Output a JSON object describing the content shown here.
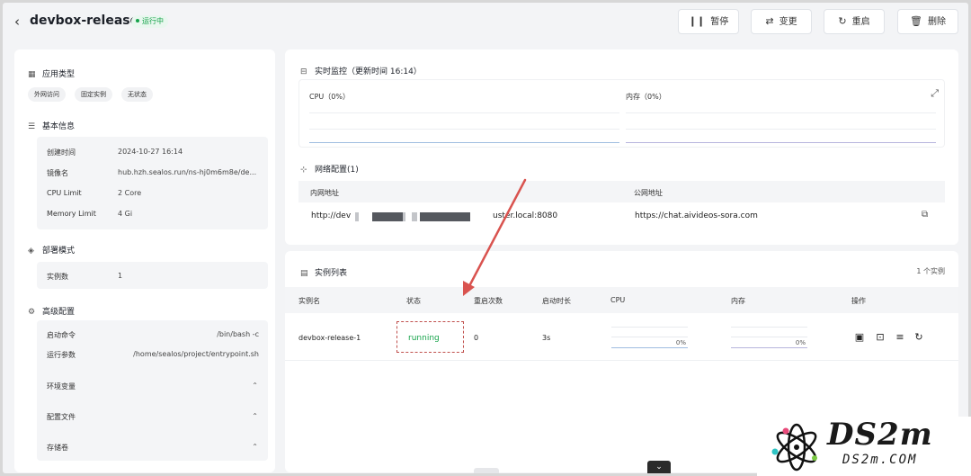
{
  "header": {
    "title": "devbox-release",
    "status": "运行中",
    "buttons": [
      {
        "label": "暂停",
        "icon": "pause-icon"
      },
      {
        "label": "变更",
        "icon": "swap-icon"
      },
      {
        "label": "重启",
        "icon": "restart-icon"
      },
      {
        "label": "删除",
        "icon": "trash-icon"
      }
    ]
  },
  "sidebar": {
    "app_type": {
      "title": "应用类型",
      "tags": [
        "外网访问",
        "固定实例",
        "无状态"
      ]
    },
    "basic_info": {
      "title": "基本信息",
      "rows": [
        {
          "k": "创建时间",
          "v": "2024-10-27 16:14"
        },
        {
          "k": "镜像名",
          "v": "hub.hzh.sealos.run/ns-hj0m6m8e/de..."
        },
        {
          "k": "CPU Limit",
          "v": "2 Core"
        },
        {
          "k": "Memory Limit",
          "v": "4 Gi"
        }
      ]
    },
    "deploy_mode": {
      "title": "部署模式",
      "rows": [
        {
          "k": "实例数",
          "v": "1"
        }
      ]
    },
    "advanced": {
      "title": "高级配置",
      "rows": [
        {
          "k": "启动命令",
          "v": "/bin/bash -c"
        },
        {
          "k": "运行参数",
          "v": "/home/sealos/project/entrypoint.sh"
        }
      ],
      "collapsibles": [
        "环境变量",
        "配置文件",
        "存储卷"
      ]
    }
  },
  "monitor": {
    "title": "实时监控（更新时间 16:14）",
    "cpu_label": "CPU（0%）",
    "mem_label": "内存（0%）"
  },
  "network": {
    "title": "网络配置(1)",
    "col_internal": "内网地址",
    "col_public": "公网地址",
    "internal_prefix": "http://dev",
    "internal_suffix": "uster.local:8080",
    "public": "https://chat.aivideos-sora.com"
  },
  "instances": {
    "title": "实例列表",
    "count": "1 个实例",
    "columns": [
      "实例名",
      "状态",
      "重启次数",
      "启动时长",
      "CPU",
      "内存",
      "操作"
    ],
    "rows": [
      {
        "name": "devbox-release-1",
        "status": "running",
        "restarts": "0",
        "uptime": "3s",
        "cpu_pct": "0%",
        "mem_pct": "0%"
      }
    ]
  },
  "watermark": {
    "big": "DS2m",
    "small": "DS2m.COM"
  }
}
